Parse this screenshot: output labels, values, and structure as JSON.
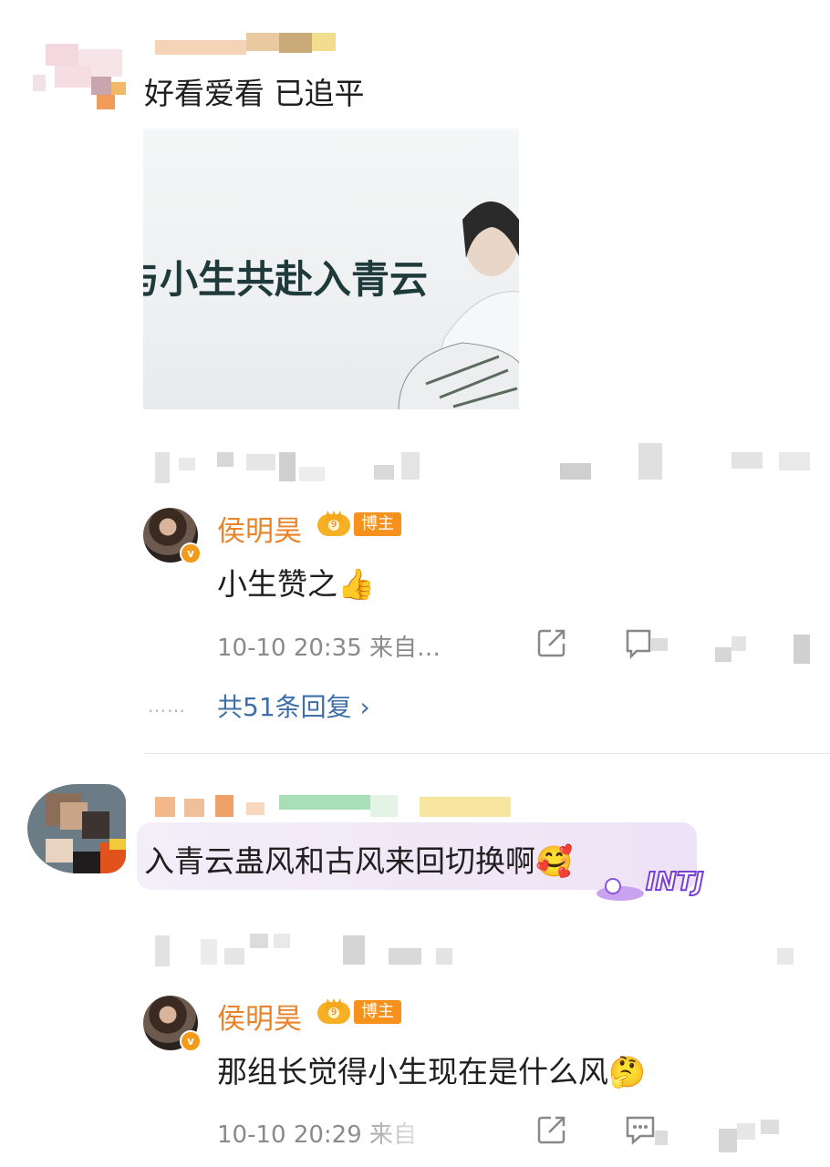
{
  "comment1": {
    "text": "好看爱看 已追平",
    "image_caption": "与小生共赴入青云"
  },
  "reply1": {
    "author": "侯明昊",
    "badge_label": "博主",
    "text": "小生赞之👍",
    "meta": "10-10 20:35 来自…",
    "replies_link": "共51条回复 ›",
    "dots": "……"
  },
  "comment2": {
    "text": "入青云蛊风和古风来回切换啊🥰",
    "sticker_text": "INTJ"
  },
  "reply2": {
    "author": "侯明昊",
    "badge_label": "博主",
    "text": "那组长觉得小生现在是什么风🤔",
    "meta": "10-10 20:29 来自"
  },
  "icons": [
    "share-icon",
    "comment-icon",
    "like-icon",
    "verified-icon",
    "crown-icon",
    "more-icon"
  ],
  "colors": {
    "name": "#e8832a",
    "badge": "#f6911e",
    "link": "#3e6fa6",
    "meta": "#8a8a8a"
  }
}
